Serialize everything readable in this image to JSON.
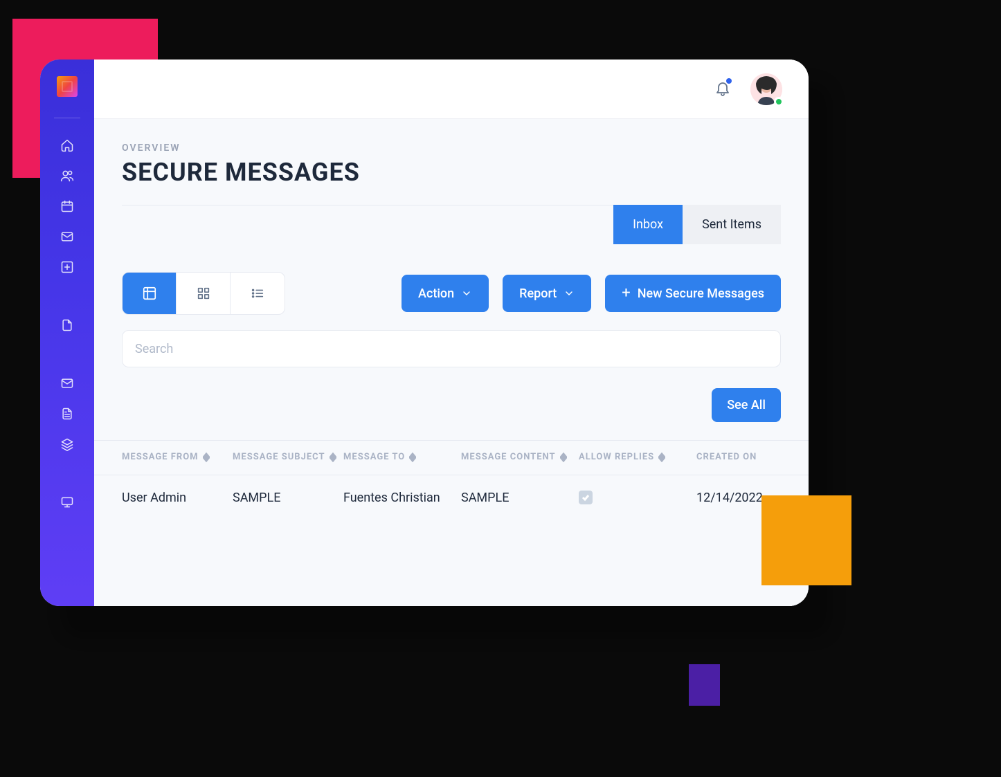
{
  "header": {
    "overview_label": "OVERVIEW",
    "title": "SECURE MESSAGES"
  },
  "tabs": {
    "inbox_label": "Inbox",
    "sent_label": "Sent Items",
    "active": "inbox"
  },
  "toolbar": {
    "action_label": "Action",
    "report_label": "Report",
    "new_label": "New Secure Messages"
  },
  "search": {
    "placeholder": "Search",
    "value": ""
  },
  "see_all_label": "See All",
  "table": {
    "columns": {
      "from": "MESSAGE FROM",
      "subject": "MESSAGE SUBJECT",
      "to": "MESSAGE TO",
      "content": "MESSAGE CONTENT",
      "allow_replies": "ALLOW REPLIES",
      "created_on": "CREATED ON"
    },
    "rows": [
      {
        "from": "User Admin",
        "subject": "SAMPLE",
        "to": "Fuentes Christian",
        "content": "SAMPLE",
        "allow_replies": true,
        "created_on": "12/14/2022"
      }
    ]
  },
  "sidebar": {
    "icons": [
      "home",
      "users",
      "calendar",
      "mail",
      "plus-square",
      "file",
      "mail-alt",
      "file-text",
      "layers",
      "monitor"
    ]
  },
  "colors": {
    "primary": "#2f80ed",
    "accent_pink": "#ed1c5c",
    "accent_orange": "#f59e0b",
    "accent_purple": "#4b1fa5"
  }
}
